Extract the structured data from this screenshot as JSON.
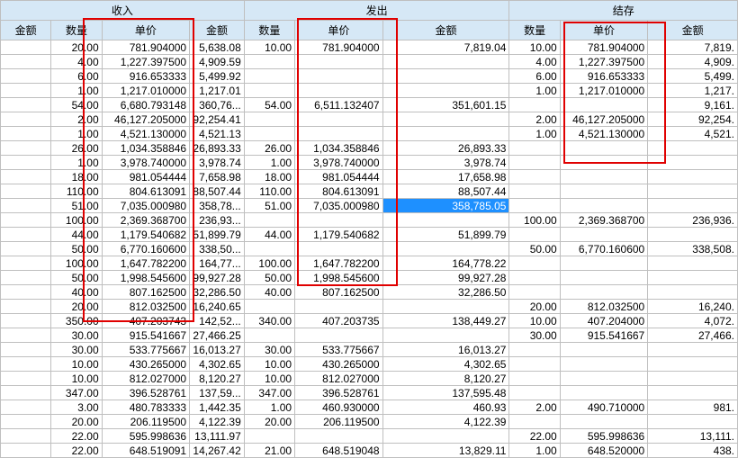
{
  "groups": {
    "in": "收入",
    "out": "发出",
    "bal": "结存"
  },
  "headers": {
    "amt1": "金额",
    "qtyIn": "数量",
    "prIn": "单价",
    "amtIn": "金额",
    "qtyOut": "数量",
    "prOut": "单价",
    "amtOut": "金额",
    "qtyBal": "数量",
    "prBal": "单价",
    "amtBal": "金额"
  },
  "rows": [
    {
      "qtyIn": "20.00",
      "prIn": "781.904000",
      "amtIn": "5,638.08",
      "qtyOut": "10.00",
      "prOut": "781.904000",
      "amtOut": "7,819.04",
      "qtyBal": "10.00",
      "prBal": "781.904000",
      "amtBal": "7,819."
    },
    {
      "qtyIn": "4.00",
      "prIn": "1,227.397500",
      "amtIn": "4,909.59",
      "qtyOut": "",
      "prOut": "",
      "amtOut": "",
      "qtyBal": "4.00",
      "prBal": "1,227.397500",
      "amtBal": "4,909."
    },
    {
      "qtyIn": "6.00",
      "prIn": "916.653333",
      "amtIn": "5,499.92",
      "qtyOut": "",
      "prOut": "",
      "amtOut": "",
      "qtyBal": "6.00",
      "prBal": "916.653333",
      "amtBal": "5,499."
    },
    {
      "qtyIn": "1.00",
      "prIn": "1,217.010000",
      "amtIn": "1,217.01",
      "qtyOut": "",
      "prOut": "",
      "amtOut": "",
      "qtyBal": "1.00",
      "prBal": "1,217.010000",
      "amtBal": "1,217."
    },
    {
      "qtyIn": "54.00",
      "prIn": "6,680.793148",
      "amtIn": "360,76...",
      "qtyOut": "54.00",
      "prOut": "6,511.132407",
      "amtOut": "351,601.15",
      "qtyBal": "",
      "prBal": "",
      "amtBal": "9,161."
    },
    {
      "qtyIn": "2.00",
      "prIn": "46,127.205000",
      "amtIn": "92,254.41",
      "qtyOut": "",
      "prOut": "",
      "amtOut": "",
      "qtyBal": "2.00",
      "prBal": "46,127.205000",
      "amtBal": "92,254."
    },
    {
      "qtyIn": "1.00",
      "prIn": "4,521.130000",
      "amtIn": "4,521.13",
      "qtyOut": "",
      "prOut": "",
      "amtOut": "",
      "qtyBal": "1.00",
      "prBal": "4,521.130000",
      "amtBal": "4,521."
    },
    {
      "qtyIn": "26.00",
      "prIn": "1,034.358846",
      "amtIn": "26,893.33",
      "qtyOut": "26.00",
      "prOut": "1,034.358846",
      "amtOut": "26,893.33",
      "qtyBal": "",
      "prBal": "",
      "amtBal": ""
    },
    {
      "qtyIn": "1.00",
      "prIn": "3,978.740000",
      "amtIn": "3,978.74",
      "qtyOut": "1.00",
      "prOut": "3,978.740000",
      "amtOut": "3,978.74",
      "qtyBal": "",
      "prBal": "",
      "amtBal": ""
    },
    {
      "qtyIn": "18.00",
      "prIn": "981.054444",
      "amtIn": "7,658.98",
      "qtyOut": "18.00",
      "prOut": "981.054444",
      "amtOut": "17,658.98",
      "qtyBal": "",
      "prBal": "",
      "amtBal": ""
    },
    {
      "qtyIn": "110.00",
      "prIn": "804.613091",
      "amtIn": "88,507.44",
      "qtyOut": "110.00",
      "prOut": "804.613091",
      "amtOut": "88,507.44",
      "qtyBal": "",
      "prBal": "",
      "amtBal": ""
    },
    {
      "qtyIn": "51.00",
      "prIn": "7,035.000980",
      "amtIn": "358,78...",
      "qtyOut": "51.00",
      "prOut": "7,035.000980",
      "amtOut": "358,785.05",
      "qtyBal": "",
      "prBal": "",
      "amtBal": "",
      "hl": true
    },
    {
      "qtyIn": "100.00",
      "prIn": "2,369.368700",
      "amtIn": "236,93...",
      "qtyOut": "",
      "prOut": "",
      "amtOut": "",
      "qtyBal": "100.00",
      "prBal": "2,369.368700",
      "amtBal": "236,936."
    },
    {
      "qtyIn": "44.00",
      "prIn": "1,179.540682",
      "amtIn": "51,899.79",
      "qtyOut": "44.00",
      "prOut": "1,179.540682",
      "amtOut": "51,899.79",
      "qtyBal": "",
      "prBal": "",
      "amtBal": ""
    },
    {
      "qtyIn": "50.00",
      "prIn": "6,770.160600",
      "amtIn": "338,50...",
      "qtyOut": "",
      "prOut": "",
      "amtOut": "",
      "qtyBal": "50.00",
      "prBal": "6,770.160600",
      "amtBal": "338,508."
    },
    {
      "qtyIn": "100.00",
      "prIn": "1,647.782200",
      "amtIn": "164,77...",
      "qtyOut": "100.00",
      "prOut": "1,647.782200",
      "amtOut": "164,778.22",
      "qtyBal": "",
      "prBal": "",
      "amtBal": ""
    },
    {
      "qtyIn": "50.00",
      "prIn": "1,998.545600",
      "amtIn": "99,927.28",
      "qtyOut": "50.00",
      "prOut": "1,998.545600",
      "amtOut": "99,927.28",
      "qtyBal": "",
      "prBal": "",
      "amtBal": ""
    },
    {
      "qtyIn": "40.00",
      "prIn": "807.162500",
      "amtIn": "32,286.50",
      "qtyOut": "40.00",
      "prOut": "807.162500",
      "amtOut": "32,286.50",
      "qtyBal": "",
      "prBal": "",
      "amtBal": ""
    },
    {
      "qtyIn": "20.00",
      "prIn": "812.032500",
      "amtIn": "16,240.65",
      "qtyOut": "",
      "prOut": "",
      "amtOut": "",
      "qtyBal": "20.00",
      "prBal": "812.032500",
      "amtBal": "16,240."
    },
    {
      "qtyIn": "350.00",
      "prIn": "407.203743",
      "amtIn": "142,52...",
      "qtyOut": "340.00",
      "prOut": "407.203735",
      "amtOut": "138,449.27",
      "qtyBal": "10.00",
      "prBal": "407.204000",
      "amtBal": "4,072."
    },
    {
      "qtyIn": "30.00",
      "prIn": "915.541667",
      "amtIn": "27,466.25",
      "qtyOut": "",
      "prOut": "",
      "amtOut": "",
      "qtyBal": "30.00",
      "prBal": "915.541667",
      "amtBal": "27,466."
    },
    {
      "qtyIn": "30.00",
      "prIn": "533.775667",
      "amtIn": "16,013.27",
      "qtyOut": "30.00",
      "prOut": "533.775667",
      "amtOut": "16,013.27",
      "qtyBal": "",
      "prBal": "",
      "amtBal": ""
    },
    {
      "qtyIn": "10.00",
      "prIn": "430.265000",
      "amtIn": "4,302.65",
      "qtyOut": "10.00",
      "prOut": "430.265000",
      "amtOut": "4,302.65",
      "qtyBal": "",
      "prBal": "",
      "amtBal": ""
    },
    {
      "qtyIn": "10.00",
      "prIn": "812.027000",
      "amtIn": "8,120.27",
      "qtyOut": "10.00",
      "prOut": "812.027000",
      "amtOut": "8,120.27",
      "qtyBal": "",
      "prBal": "",
      "amtBal": ""
    },
    {
      "qtyIn": "347.00",
      "prIn": "396.528761",
      "amtIn": "137,59...",
      "qtyOut": "347.00",
      "prOut": "396.528761",
      "amtOut": "137,595.48",
      "qtyBal": "",
      "prBal": "",
      "amtBal": ""
    },
    {
      "qtyIn": "3.00",
      "prIn": "480.783333",
      "amtIn": "1,442.35",
      "qtyOut": "1.00",
      "prOut": "460.930000",
      "amtOut": "460.93",
      "qtyBal": "2.00",
      "prBal": "490.710000",
      "amtBal": "981."
    },
    {
      "qtyIn": "20.00",
      "prIn": "206.119500",
      "amtIn": "4,122.39",
      "qtyOut": "20.00",
      "prOut": "206.119500",
      "amtOut": "4,122.39",
      "qtyBal": "",
      "prBal": "",
      "amtBal": ""
    },
    {
      "qtyIn": "22.00",
      "prIn": "595.998636",
      "amtIn": "13,111.97",
      "qtyOut": "",
      "prOut": "",
      "amtOut": "",
      "qtyBal": "22.00",
      "prBal": "595.998636",
      "amtBal": "13,111."
    },
    {
      "qtyIn": "22.00",
      "prIn": "648.519091",
      "amtIn": "14,267.42",
      "qtyOut": "21.00",
      "prOut": "648.519048",
      "amtOut": "13,829.11",
      "qtyBal": "1.00",
      "prBal": "648.520000",
      "amtBal": "438."
    }
  ]
}
